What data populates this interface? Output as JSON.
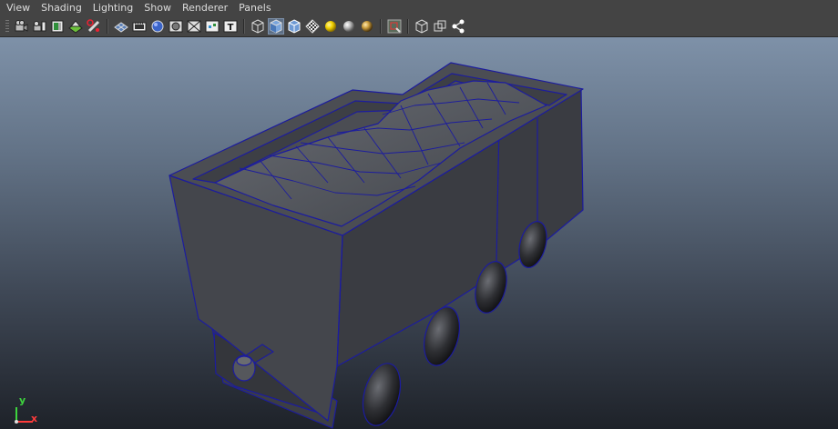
{
  "menubar": {
    "items": [
      "View",
      "Shading",
      "Lighting",
      "Show",
      "Renderer",
      "Panels"
    ]
  },
  "toolbar": {
    "icons": [
      "camera-attribute-icon",
      "camera-bookmark-icon",
      "image-plane-icon",
      "2d-pan-zoom-icon",
      "grease-pencil-icon",
      "grid-icon",
      "film-gate-icon",
      "resolution-gate-icon",
      "gate-mask-icon",
      "field-chart-icon",
      "safe-action-icon",
      "safe-title-icon",
      "wireframe-icon",
      "smooth-shade-all-icon",
      "wireframe-on-shaded-icon",
      "xray-icon",
      "use-default-material-icon",
      "textured-icon",
      "use-all-lights-icon",
      "shadows-icon",
      "isolate-select-icon",
      "xray-joints-icon",
      "xray-active-components-icon",
      "node-graph-icon"
    ]
  },
  "viewport": {
    "axis_labels": {
      "y": "y",
      "x": "x"
    },
    "colors": {
      "wire": "#1c1c9e",
      "body": "#45474d",
      "axis_y": "#3ed43e",
      "axis_x": "#ff3b3b"
    }
  }
}
